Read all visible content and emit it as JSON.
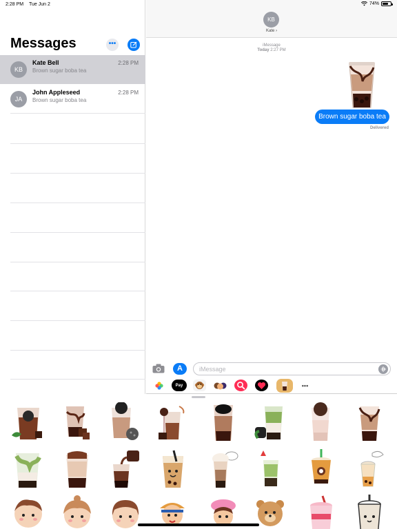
{
  "status_bar": {
    "time": "2:28 PM",
    "date": "Tue Jun 2",
    "battery": "74%"
  },
  "sidebar": {
    "title": "Messages",
    "conversations": [
      {
        "initials": "KB",
        "name": "Kate Bell",
        "time": "2:28 PM",
        "preview": "Brown sugar boba tea",
        "selected": true
      },
      {
        "initials": "JA",
        "name": "John Appleseed",
        "time": "2:28 PM",
        "preview": "Brown sugar boba tea",
        "selected": false
      }
    ]
  },
  "chat": {
    "contact_initials": "KB",
    "contact_name": "Kate ›",
    "service": "iMessage",
    "timestamp_day": "Today",
    "timestamp_time": "2:27 PM",
    "messages": [
      {
        "type": "sticker",
        "desc": "brown-sugar-boba-cup"
      },
      {
        "type": "text",
        "text": "Brown sugar boba tea"
      }
    ],
    "status": "Delivered"
  },
  "input": {
    "placeholder": "iMessage"
  },
  "app_strip": {
    "apple_pay_label": "Pay",
    "more_label": "•••"
  },
  "colors": {
    "accent": "#0a7cf7",
    "bubble": "#0a7cf7",
    "avatar": "#9b9ea6",
    "selected_row": "#d1d1d6"
  },
  "stickers": {
    "row1": [
      "boba-bowl-matcha",
      "choco-boba-cubes",
      "boba-cookie-tea",
      "boba-cake-pop",
      "tall-brown-boba",
      "matcha-boba-mug",
      "pink-boba-cup",
      "brown-sugar-boba-cup"
    ],
    "row2": [
      "matcha-milk-boba",
      "choco-milk-boba",
      "pouring-boba",
      "smiling-boba-cup",
      "whipped-cream-boba",
      "strawberry-matcha-boba",
      "cute-boba-drink",
      "doodle-boba-drink"
    ],
    "row3": [
      "boy-with-boba",
      "girl-with-boba",
      "girl-bangs-boba",
      "cowboy-boy-boba",
      "pink-hat-girl-boba",
      "bear-with-boba",
      "pink-boba-takeaway",
      "kawaii-boba-cup"
    ]
  }
}
